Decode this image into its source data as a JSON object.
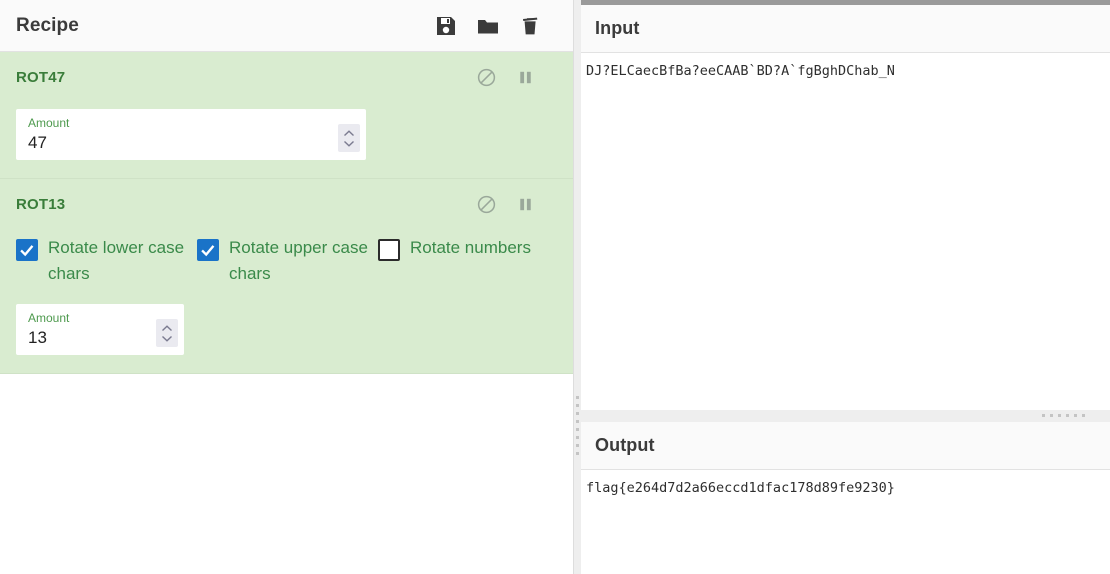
{
  "recipe": {
    "title": "Recipe",
    "title_icons": [
      {
        "name": "save-icon",
        "label": "Save recipe"
      },
      {
        "name": "folder-icon",
        "label": "Load recipe"
      },
      {
        "name": "trash-icon",
        "label": "Clear recipe"
      }
    ],
    "operations": [
      {
        "name": "ROT47",
        "icons": [
          {
            "name": "disable-icon",
            "label": "Disable operation"
          },
          {
            "name": "pause-icon",
            "label": "Set breakpoint"
          }
        ],
        "number_arg": {
          "label": "Amount",
          "value": "47"
        },
        "checkboxes": []
      },
      {
        "name": "ROT13",
        "icons": [
          {
            "name": "disable-icon",
            "label": "Disable operation"
          },
          {
            "name": "pause-icon",
            "label": "Set breakpoint"
          }
        ],
        "number_arg": {
          "label": "Amount",
          "value": "13"
        },
        "checkboxes": [
          {
            "label": "Rotate lower case chars",
            "checked": true
          },
          {
            "label": "Rotate upper case chars",
            "checked": true
          },
          {
            "label": "Rotate numbers",
            "checked": false
          }
        ]
      }
    ]
  },
  "input": {
    "title": "Input",
    "value": "DJ?ELCaecBfBa?eeCAAB`BD?A`fgBghDChab_N"
  },
  "output": {
    "title": "Output",
    "value": "flag{e264d7d2a66eccd1dfac178d89fe9230}"
  },
  "colors": {
    "operation_bg": "#d9ecd0",
    "operation_name": "#3a7d3a",
    "checkbox_checked": "#1a73c8",
    "label_green": "#4e9a4e",
    "panel_header_bg": "#fafafa"
  }
}
